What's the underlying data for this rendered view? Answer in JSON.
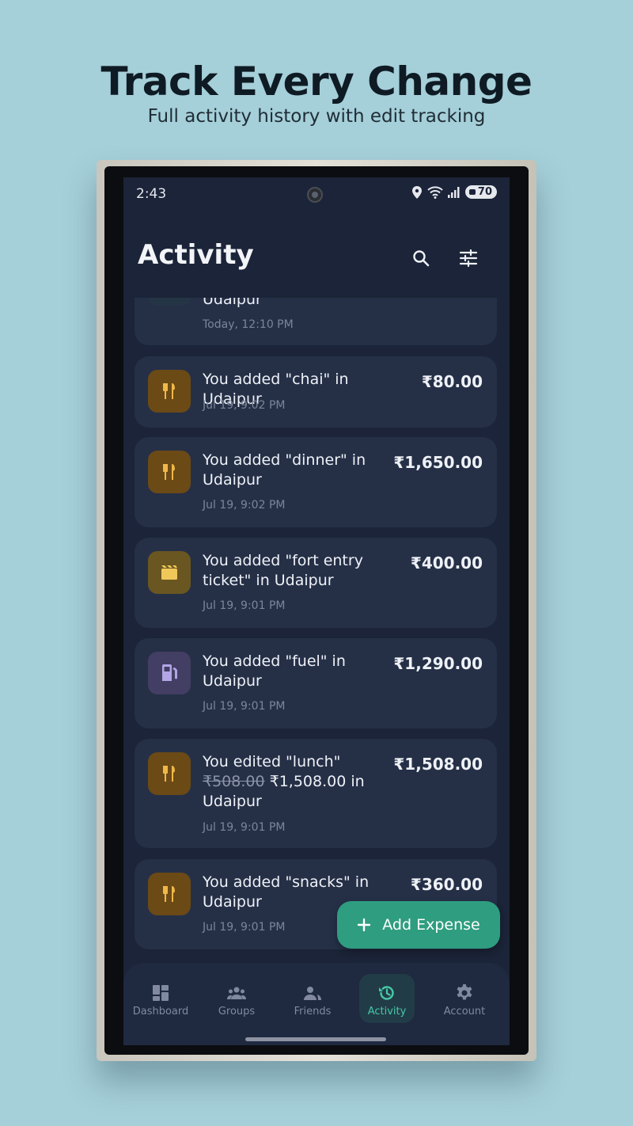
{
  "promo": {
    "title": "Track Every Change",
    "subtitle": "Full activity history with edit tracking"
  },
  "status_bar": {
    "time": "2:43",
    "battery": "70",
    "icons": [
      "location-icon",
      "wifi-icon",
      "signal-icon",
      "battery-icon"
    ]
  },
  "header": {
    "title": "Activity",
    "actions": [
      "search-icon",
      "filter-sliders-icon"
    ]
  },
  "activities": [
    {
      "title": "Udaipur",
      "amount": "",
      "time": "Today, 12:10 PM",
      "icon": "partial",
      "color": "#2a3a4a"
    },
    {
      "title": "You added \"chai\" in Udaipur",
      "amount": "₹80.00",
      "time": "Jul 19, 9:02 PM",
      "icon": "fork-knife-icon",
      "color": "#6b4a16"
    },
    {
      "title": "You added \"dinner\" in Udaipur",
      "amount": "₹1,650.00",
      "time": "Jul 19, 9:02 PM",
      "icon": "fork-knife-icon",
      "color": "#6b4a16"
    },
    {
      "title": "You added \"fort entry ticket\" in Udaipur",
      "amount": "₹400.00",
      "time": "Jul 19, 9:01 PM",
      "icon": "clapperboard-icon",
      "color": "#6a5620"
    },
    {
      "title": "You added \"fuel\" in Udaipur",
      "amount": "₹1,290.00",
      "time": "Jul 19, 9:01 PM",
      "icon": "fuel-pump-icon",
      "color": "#433e63"
    },
    {
      "title_prefix": "You edited \"lunch\"",
      "old_amount": "₹508.00",
      "title_suffix": "₹1,508.00 in Udaipur",
      "amount": "₹1,508.00",
      "time": "Jul 19, 9:01 PM",
      "icon": "fork-knife-icon",
      "color": "#6b4a16"
    },
    {
      "title": "You added \"snacks\" in Udaipur",
      "amount": "₹360.00",
      "time": "Jul 19, 9:01 PM",
      "icon": "fork-knife-icon",
      "color": "#6b4a16"
    }
  ],
  "fab": {
    "label": "Add Expense",
    "icon": "plus-icon"
  },
  "nav": [
    {
      "label": "Dashboard",
      "icon": "dashboard-icon",
      "active": false
    },
    {
      "label": "Groups",
      "icon": "groups-icon",
      "active": false
    },
    {
      "label": "Friends",
      "icon": "friends-icon",
      "active": false
    },
    {
      "label": "Activity",
      "icon": "history-icon",
      "active": true
    },
    {
      "label": "Account",
      "icon": "gear-icon",
      "active": false
    }
  ],
  "colors": {
    "background": "#a5cfd9",
    "screen": "#1b2438",
    "card": "#253047",
    "accent": "#2f9d80",
    "active_nav": "#46c9a8"
  }
}
